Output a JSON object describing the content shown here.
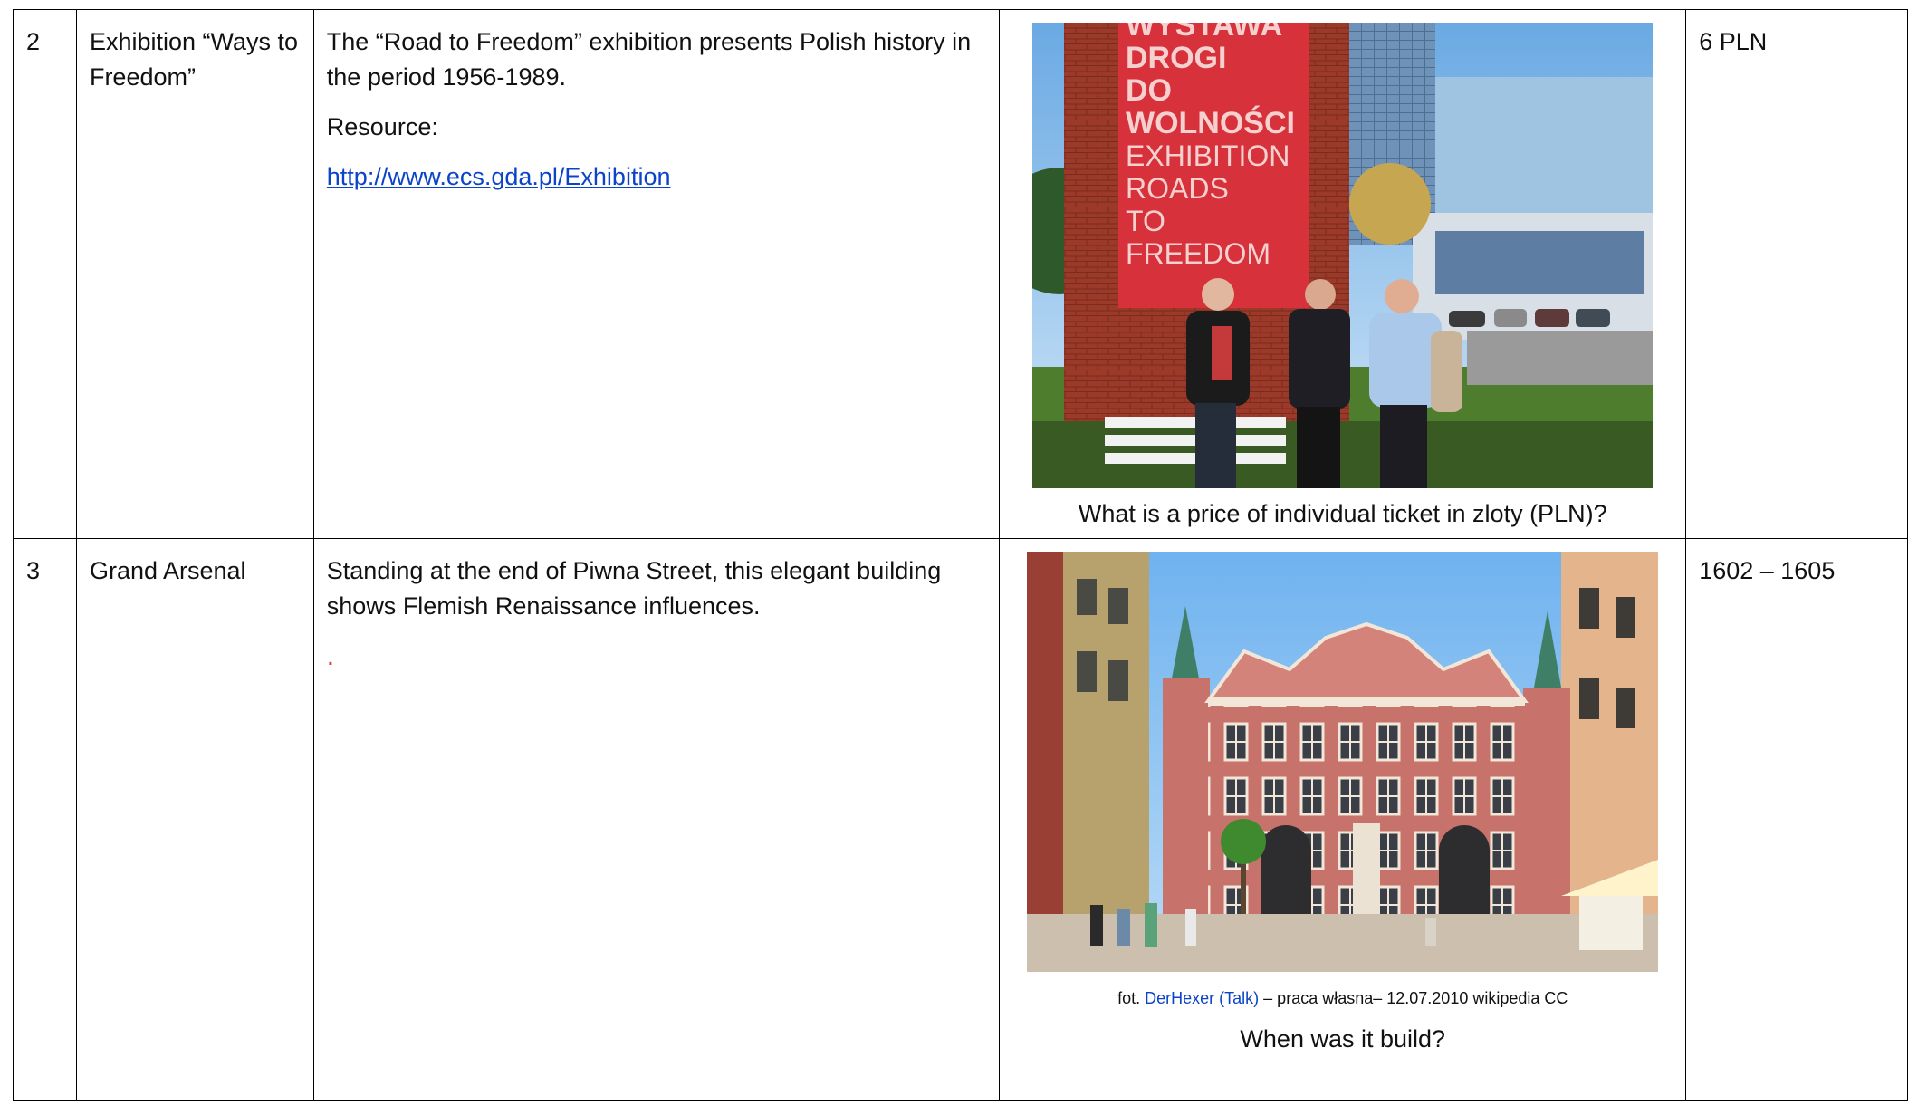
{
  "rows": [
    {
      "number": "2",
      "name": "Exhibition “Ways to Freedom”",
      "description": "The “Road to Freedom” exhibition presents Polish history  in the period 1956-1989.",
      "resource_label": "Resource:",
      "resource_link": "http://www.ecs.gda.pl/Exhibition",
      "photo": {
        "banner_lines_bold": [
          "WYSTAWA",
          "DROGI",
          "DO",
          "WOLNOŚCI"
        ],
        "banner_lines_light": [
          "EXHIBITION",
          "ROADS",
          "TO",
          "FREEDOM"
        ]
      },
      "question": "What is a price of individual ticket in zloty (PLN)?",
      "answer": "6 PLN"
    },
    {
      "number": "3",
      "name": "Grand Arsenal",
      "description": "Standing at the end of Piwna Street, this elegant building shows Flemish Renaissance influences.",
      "note_mark": ".",
      "photo_credit": {
        "prefix": "fot.",
        "author": "DerHexer",
        "talk": "(Talk)",
        "suffix": "– praca własna– 12.07.2010 wikipedia CC"
      },
      "question": "When was it build?",
      "answer": "1602 – 1605"
    }
  ],
  "colors": {
    "link": "#0b44c8",
    "banner_red": "#d7313b",
    "brick": "#9c3a2a",
    "sky": "#8fc3ee",
    "facade": "#c7726a"
  }
}
